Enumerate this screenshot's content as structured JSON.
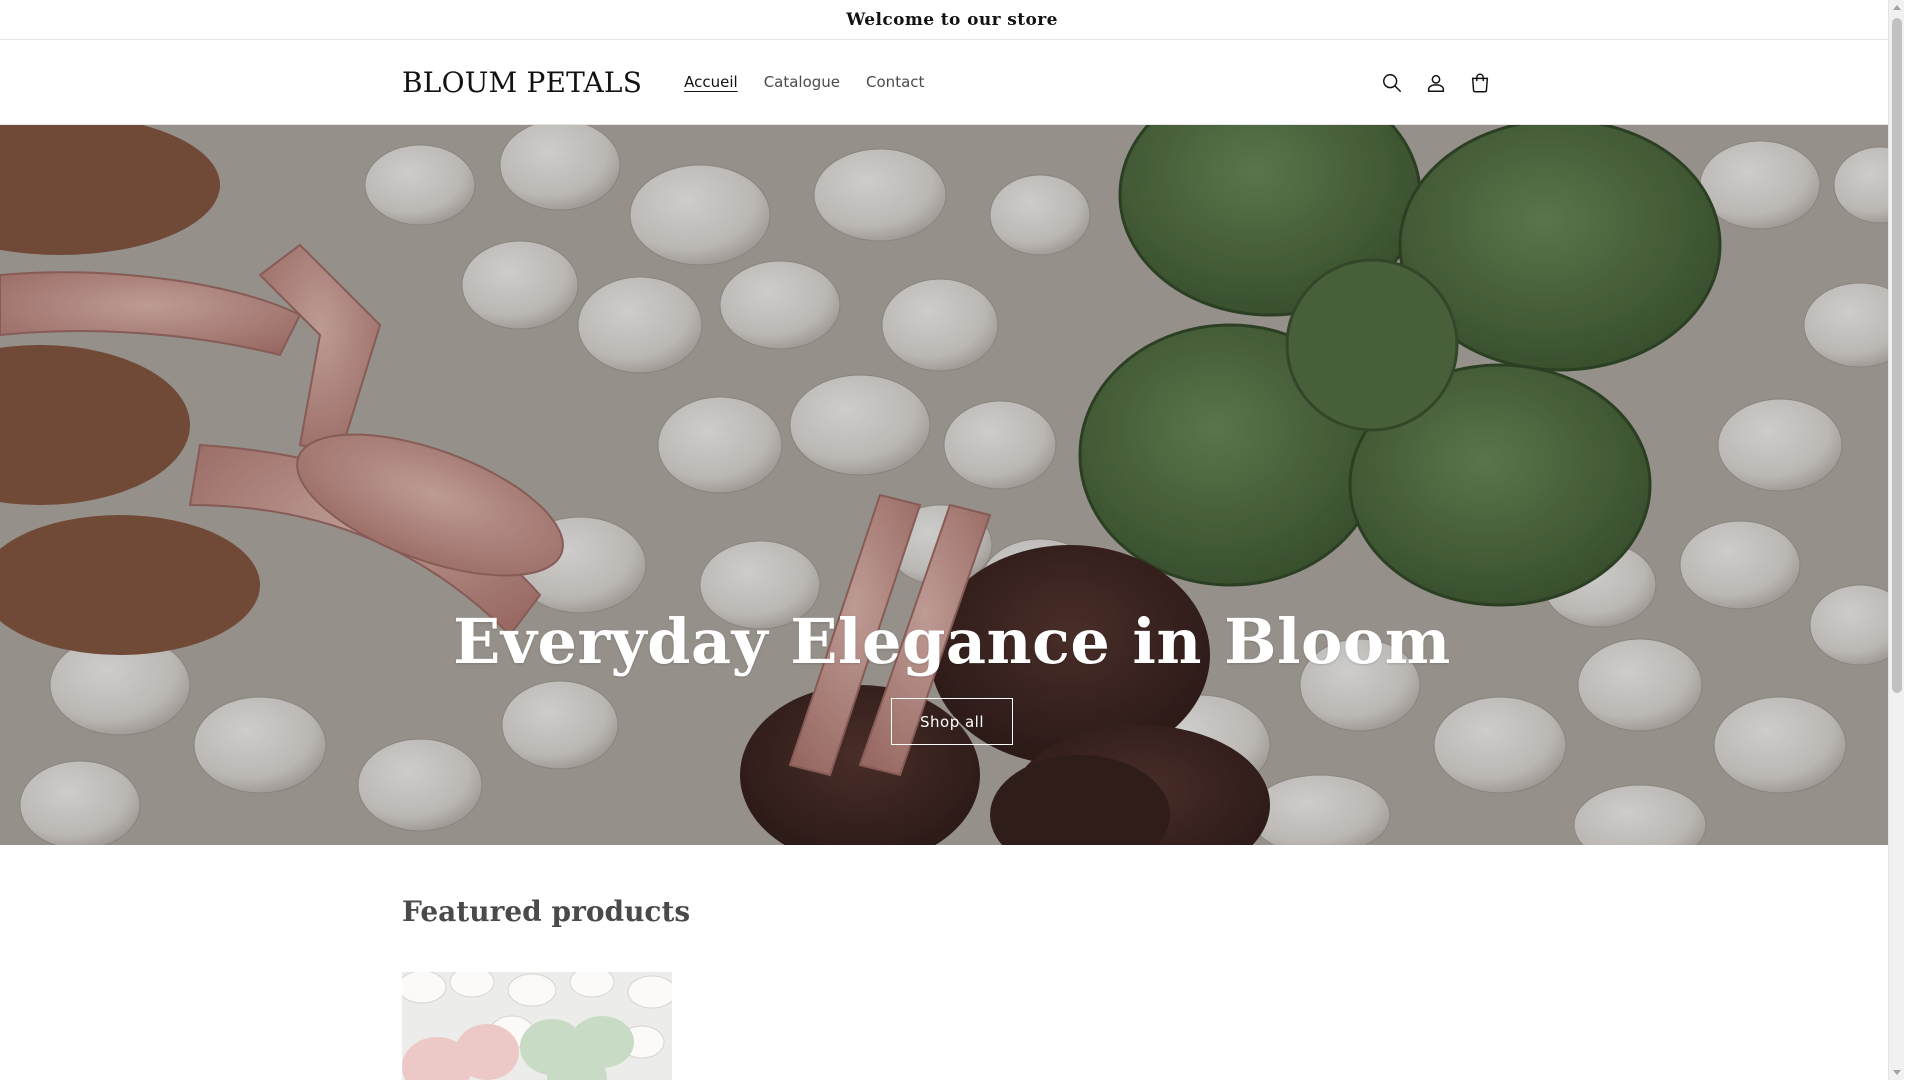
{
  "announcement": {
    "text": "Welcome to our store"
  },
  "header": {
    "logo": "BLOUM PETALS",
    "nav": [
      {
        "label": "Accueil",
        "active": true
      },
      {
        "label": "Catalogue",
        "active": false
      },
      {
        "label": "Contact",
        "active": false
      }
    ],
    "icons": [
      "search-icon",
      "account-icon",
      "cart-icon"
    ]
  },
  "hero": {
    "title": "Everyday Elegance in Bloom",
    "button_label": "Shop all"
  },
  "featured": {
    "title": "Featured products"
  },
  "colors": {
    "text": "#121212",
    "nav_text": "#4a4a4a",
    "border": "#e6e6e6",
    "hero_pink": "#d9a9a1",
    "hero_green": "#5f7d4c",
    "hero_brown": "#4e2f2a"
  }
}
